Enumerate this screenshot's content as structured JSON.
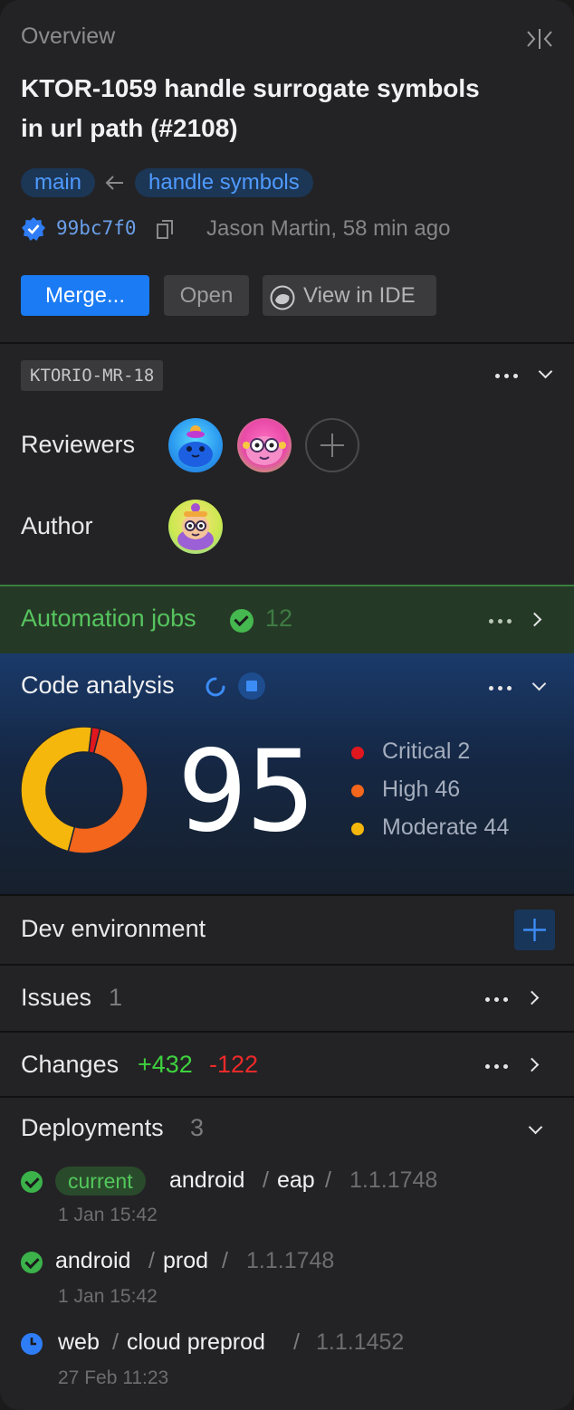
{
  "header": {
    "overview_label": "Overview",
    "title_line1": "KTOR-1059 handle surrogate symbols",
    "title_line2": "in url path (#2108)",
    "target_branch": "main",
    "source_branch": "handle symbols",
    "commit_hash": "99bc7f0",
    "commit_meta": "Jason Martin, 58 min ago",
    "merge_label": "Merge...",
    "open_label": "Open",
    "ide_label": "View in IDE"
  },
  "review": {
    "mr_id": "KTORIO-MR-18",
    "reviewers_label": "Reviewers",
    "author_label": "Author"
  },
  "automation": {
    "label": "Automation jobs",
    "count": "12",
    "color": "#4ac25a"
  },
  "code_analysis": {
    "label": "Code analysis",
    "score": "95",
    "legend": [
      {
        "label": "Critical 2",
        "color": "#e0171e"
      },
      {
        "label": "High 46",
        "color": "#f4661b"
      },
      {
        "label": "Moderate 44",
        "color": "#f6b70c"
      }
    ]
  },
  "chart_data": {
    "type": "pie",
    "categories": [
      "Critical",
      "High",
      "Moderate"
    ],
    "values": [
      2,
      46,
      44
    ],
    "colors": [
      "#e0171e",
      "#f4661b",
      "#f6b70c"
    ]
  },
  "dev_environment": {
    "label": "Dev environment"
  },
  "issues": {
    "label": "Issues",
    "count": "1"
  },
  "changes": {
    "label": "Changes",
    "added": "+432",
    "removed": "-122"
  },
  "deployments": {
    "label": "Deployments",
    "count": "3",
    "items": [
      {
        "badge": "current",
        "target": "android",
        "env": "eap",
        "version": "1.1.1748",
        "time": "1 Jan 15:42",
        "status": "success"
      },
      {
        "target": "android",
        "env": "prod",
        "version": "1.1.1748",
        "time": "1 Jan 15:42",
        "status": "success"
      },
      {
        "target": "web",
        "env": "cloud preprod",
        "version": "1.1.1452",
        "time": "27 Feb 11:23",
        "status": "scheduled"
      }
    ]
  }
}
